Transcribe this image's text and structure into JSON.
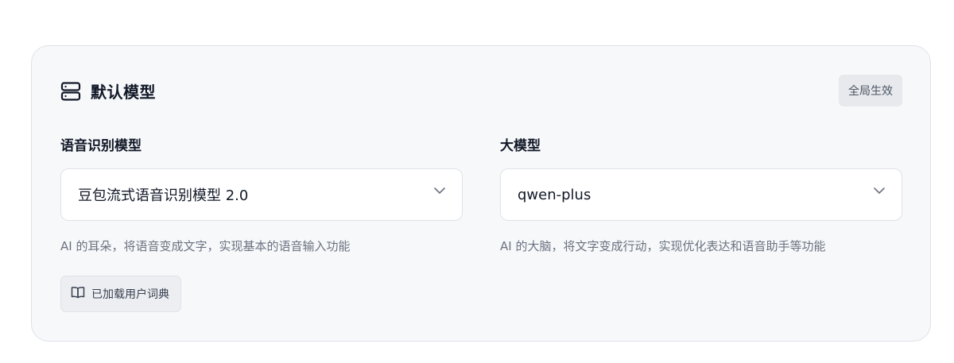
{
  "card": {
    "title": "默认模型",
    "title_icon": "server-icon",
    "scope_badge": "全局生效"
  },
  "asr": {
    "label": "语音识别模型",
    "selected": "豆包流式语音识别模型 2.0",
    "description": "AI 的耳朵，将语音变成文字，实现基本的语音输入功能",
    "dict_button": "已加载用户词典",
    "dict_icon": "book-icon"
  },
  "llm": {
    "label": "大模型",
    "selected": "qwen-plus",
    "description": "AI 的大脑，将文字变成行动，实现优化表达和语音助手等功能"
  },
  "colors": {
    "card_bg": "#f7f8fa",
    "border": "#dfe2e7",
    "text_primary": "#111827",
    "text_secondary": "#6b7280"
  }
}
